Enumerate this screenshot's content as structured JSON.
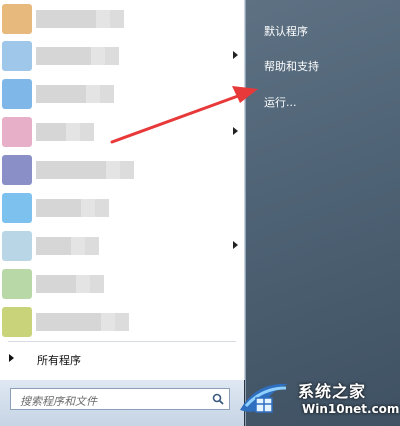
{
  "start_menu": {
    "left": {
      "programs": [
        {
          "label": "",
          "has_submenu": true,
          "icon_color": "#e8b97c"
        },
        {
          "label": "",
          "has_submenu": true,
          "icon_color": "#9fc7ea"
        },
        {
          "label": "",
          "has_submenu": false,
          "icon_color": "#7fb8e8"
        },
        {
          "label": "",
          "has_submenu": true,
          "icon_color": "#e7b0c8"
        },
        {
          "label": "",
          "has_submenu": false,
          "icon_color": "#8b8fc8"
        },
        {
          "label": "",
          "has_submenu": false,
          "icon_color": "#7dc2ee"
        },
        {
          "label": "",
          "has_submenu": true,
          "icon_color": "#b9d6e6"
        },
        {
          "label": "",
          "has_submenu": false,
          "icon_color": "#b8d8a8"
        },
        {
          "label": "",
          "has_submenu": false,
          "icon_color": "#c9d47a"
        }
      ],
      "all_programs_label": "所有程序",
      "search_placeholder": "搜索程序和文件"
    },
    "right": {
      "items": [
        {
          "label": "默认程序"
        },
        {
          "label": "帮助和支持"
        },
        {
          "label": "运行..."
        }
      ]
    }
  },
  "watermark": {
    "title": "系统之家",
    "url": "Win10net.com"
  },
  "colors": {
    "right_pane": "#51667a",
    "annotation_arrow": "#e8393a"
  }
}
